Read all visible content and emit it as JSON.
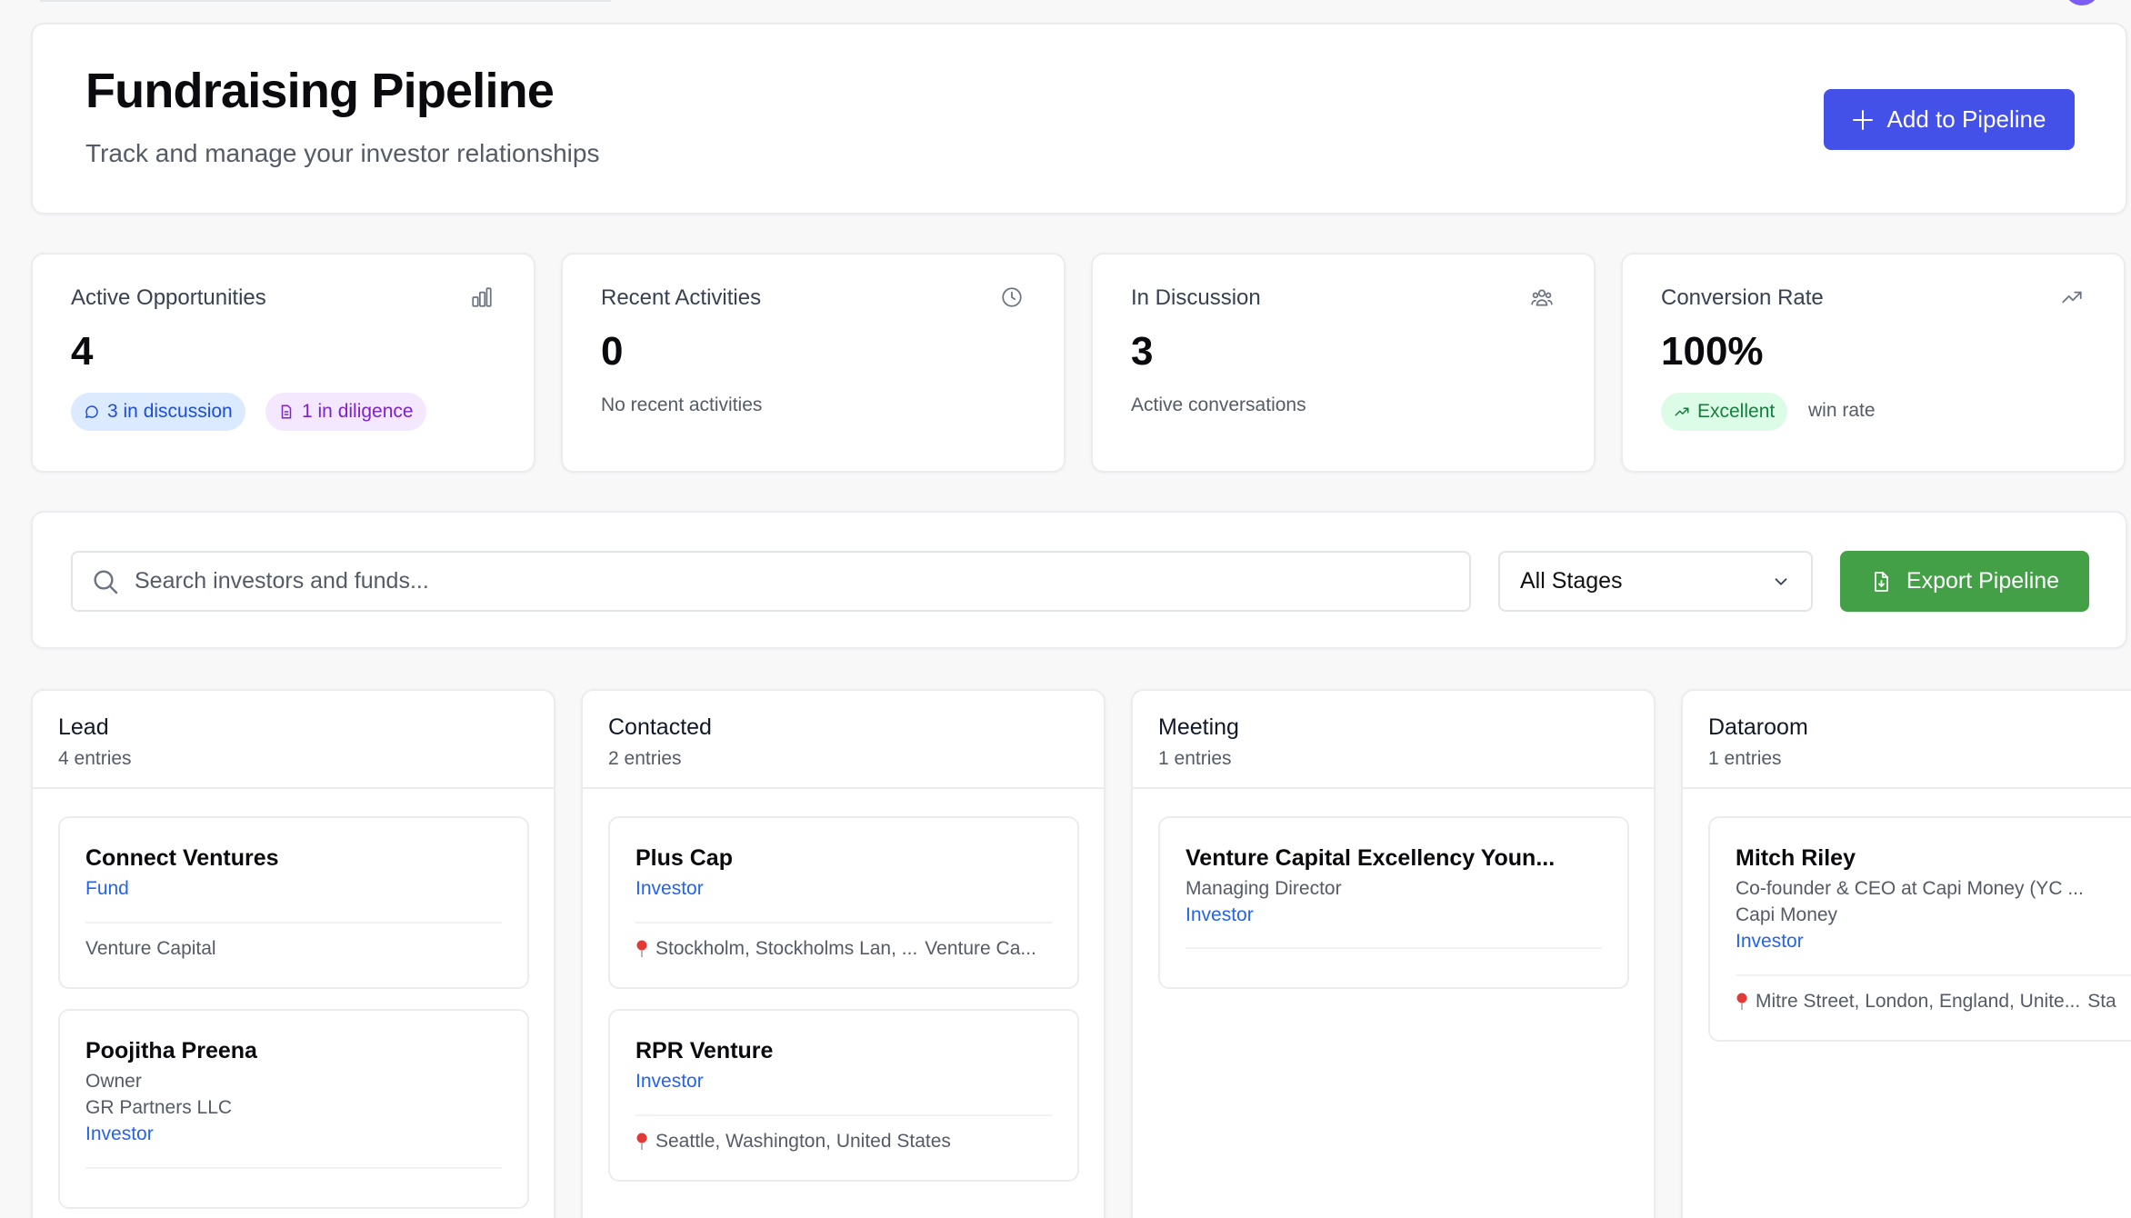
{
  "header": {
    "title": "Fundraising Pipeline",
    "subtitle": "Track and manage your investor relationships",
    "add_button": "Add to Pipeline"
  },
  "stats": {
    "active": {
      "label": "Active Opportunities",
      "value": "4",
      "pill_discussion": "3 in discussion",
      "pill_diligence": "1 in diligence",
      "icon": "bar-chart-icon"
    },
    "recent": {
      "label": "Recent Activities",
      "value": "0",
      "note": "No recent activities",
      "icon": "clock-icon"
    },
    "discussion": {
      "label": "In Discussion",
      "value": "3",
      "note": "Active conversations",
      "icon": "users-icon"
    },
    "conversion": {
      "label": "Conversion Rate",
      "value": "100%",
      "pill": "Excellent",
      "suffix": "win rate",
      "icon": "trending-up-icon"
    }
  },
  "filters": {
    "search_placeholder": "Search investors and funds...",
    "stage_selected": "All Stages",
    "export_button": "Export Pipeline"
  },
  "columns": [
    {
      "title": "Lead",
      "count": "4 entries",
      "entries": [
        {
          "name": "Connect Ventures",
          "tag": "Fund",
          "footer": "Venture Capital"
        },
        {
          "name": "Poojitha Preena",
          "role": "Owner",
          "company": "GR Partners LLC",
          "tag": "Investor"
        }
      ]
    },
    {
      "title": "Contacted",
      "count": "2 entries",
      "entries": [
        {
          "name": "Plus Cap",
          "tag": "Investor",
          "location": "Stockholm, Stockholms Lan, ...",
          "extra": "Venture Ca..."
        },
        {
          "name": "RPR Venture",
          "tag": "Investor",
          "location": "Seattle, Washington, United States"
        }
      ]
    },
    {
      "title": "Meeting",
      "count": "1 entries",
      "entries": [
        {
          "name": "Venture Capital Excellency Youn...",
          "role": "Managing Director",
          "tag": "Investor"
        }
      ]
    },
    {
      "title": "Dataroom",
      "count": "1 entries",
      "entries": [
        {
          "name": "Mitch Riley",
          "role": "Co-founder & CEO at Capi Money (YC ...",
          "company": "Capi Money",
          "tag": "Investor",
          "location": "Mitre Street, London, England, Unite...",
          "extra": "Sta"
        }
      ]
    }
  ],
  "colors": {
    "primary": "#4451e8",
    "export": "#43a047",
    "tag": "#2563eb"
  }
}
